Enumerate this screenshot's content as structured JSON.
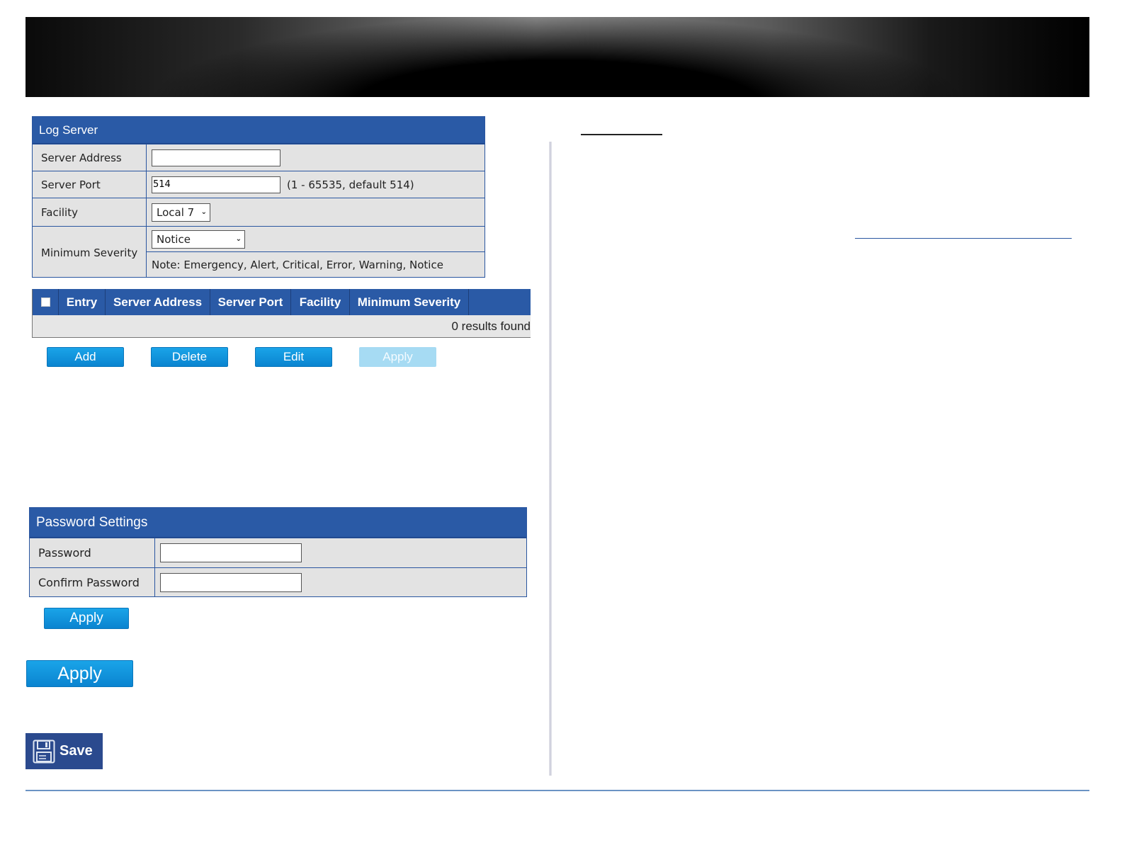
{
  "log_server": {
    "title": "Log Server",
    "server_address_label": "Server Address",
    "server_address_value": "",
    "server_port_label": "Server Port",
    "server_port_value": "514",
    "server_port_hint": "(1 - 65535, default 514)",
    "facility_label": "Facility",
    "facility_value": "Local 7",
    "min_severity_label": "Minimum Severity",
    "min_severity_value": "Notice",
    "note": "Note: Emergency, Alert, Critical, Error, Warning, Notice"
  },
  "table": {
    "columns": [
      "Entry",
      "Server Address",
      "Server Port",
      "Facility",
      "Minimum Severity"
    ],
    "status": "0 results found"
  },
  "buttons": {
    "add": "Add",
    "delete": "Delete",
    "edit": "Edit",
    "apply": "Apply"
  },
  "password_settings": {
    "title": "Password Settings",
    "password_label": "Password",
    "password_value": "",
    "confirm_label": "Confirm Password",
    "confirm_value": "",
    "apply": "Apply"
  },
  "large_apply": "Apply",
  "save": "Save",
  "colors": {
    "panel_header": "#2a5aa6",
    "button_blue": "#0a84d0",
    "button_disabled": "#a6dbf3",
    "save_button": "#2b4a8e"
  }
}
